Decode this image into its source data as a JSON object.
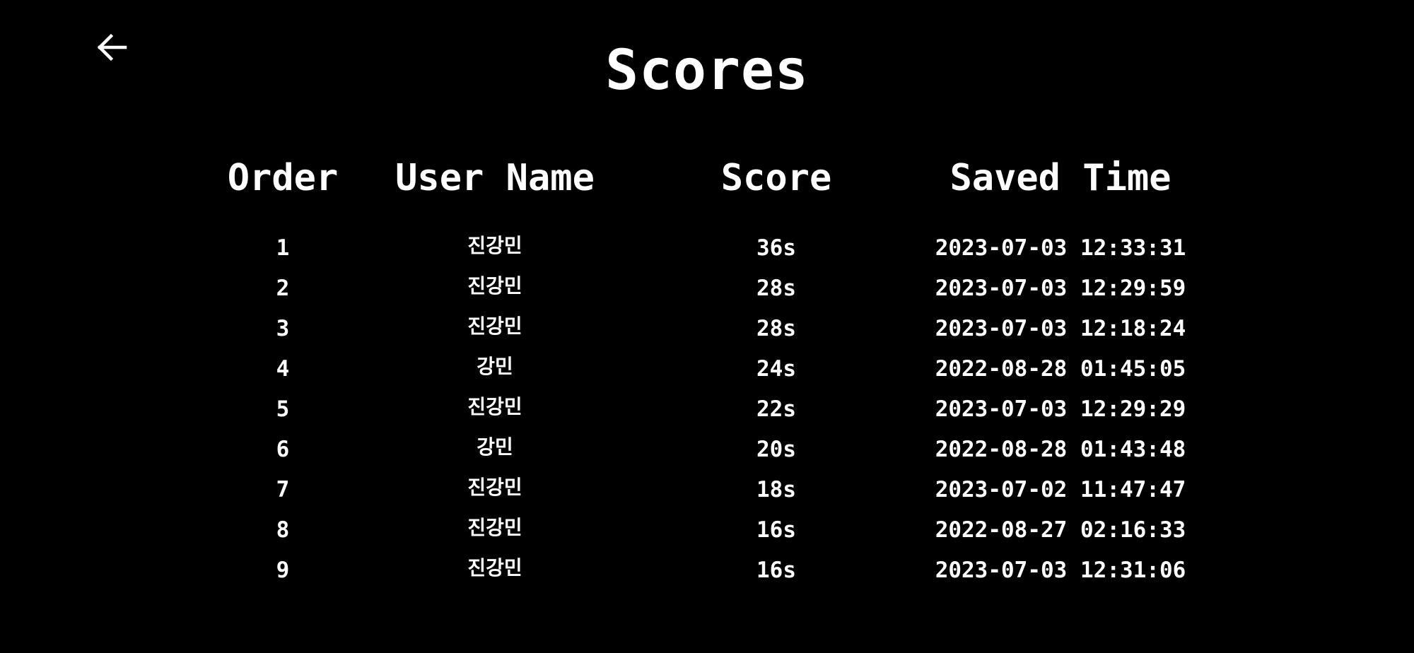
{
  "header": {
    "back_icon": "arrow-left-icon",
    "title": "Scores"
  },
  "table": {
    "columns": [
      "Order",
      "User Name",
      "Score",
      "Saved Time"
    ],
    "rows": [
      {
        "order": "1",
        "user_name": "진강민",
        "score": "36s",
        "saved_time": "2023-07-03 12:33:31"
      },
      {
        "order": "2",
        "user_name": "진강민",
        "score": "28s",
        "saved_time": "2023-07-03 12:29:59"
      },
      {
        "order": "3",
        "user_name": "진강민",
        "score": "28s",
        "saved_time": "2023-07-03 12:18:24"
      },
      {
        "order": "4",
        "user_name": "강민",
        "score": "24s",
        "saved_time": "2022-08-28 01:45:05"
      },
      {
        "order": "5",
        "user_name": "진강민",
        "score": "22s",
        "saved_time": "2023-07-03 12:29:29"
      },
      {
        "order": "6",
        "user_name": "강민",
        "score": "20s",
        "saved_time": "2022-08-28 01:43:48"
      },
      {
        "order": "7",
        "user_name": "진강민",
        "score": "18s",
        "saved_time": "2023-07-02 11:47:47"
      },
      {
        "order": "8",
        "user_name": "진강민",
        "score": "16s",
        "saved_time": "2022-08-27 02:16:33"
      },
      {
        "order": "9",
        "user_name": "진강민",
        "score": "16s",
        "saved_time": "2023-07-03 12:31:06"
      }
    ]
  },
  "colors": {
    "background": "#000000",
    "text": "#ffffff"
  }
}
